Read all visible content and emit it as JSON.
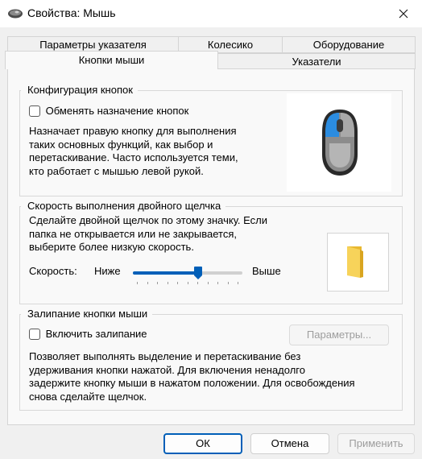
{
  "window": {
    "title": "Свойства: Мышь"
  },
  "tabs": {
    "back_row": [
      "Параметры указателя",
      "Колесико",
      "Оборудование"
    ],
    "front_row": [
      "Кнопки мыши",
      "Указатели"
    ],
    "active": "Кнопки мыши"
  },
  "button_config": {
    "group_title": "Конфигурация кнопок",
    "swap_label": "Обменять назначение кнопок",
    "swap_checked": false,
    "description": [
      "Назначает правую кнопку для выполнения",
      "таких основных функций, как выбор и",
      "перетаскивание. Часто используется теми,",
      "кто работает с мышью левой рукой."
    ]
  },
  "double_click": {
    "group_title": "Скорость выполнения двойного щелчка",
    "description": [
      "Сделайте двойной щелчок по этому значку. Если",
      "папка не открывается или не закрывается,",
      "выберите более низкую скорость."
    ],
    "speed_label": "Скорость:",
    "slow_label": "Ниже",
    "fast_label": "Выше",
    "speed_value": 0.6,
    "tick_count": 11
  },
  "click_lock": {
    "group_title": "Залипание кнопки мыши",
    "enable_label": "Включить залипание",
    "enable_checked": false,
    "settings_button": "Параметры...",
    "description": [
      "Позволяет выполнять выделение и перетаскивание без",
      "удерживания кнопки нажатой. Для включения ненадолго",
      "задержите кнопку мыши в нажатом положении. Для освобождения",
      "снова сделайте щелчок."
    ]
  },
  "footer": {
    "ok": "ОК",
    "cancel": "Отмена",
    "apply": "Применить"
  },
  "colors": {
    "accent": "#005fb8",
    "mouse_button_highlight": "#2b8ce0"
  },
  "icons": {
    "title": "mouse-icon",
    "close": "close-icon",
    "preview": "mouse-preview-icon",
    "folder": "folder-icon"
  }
}
